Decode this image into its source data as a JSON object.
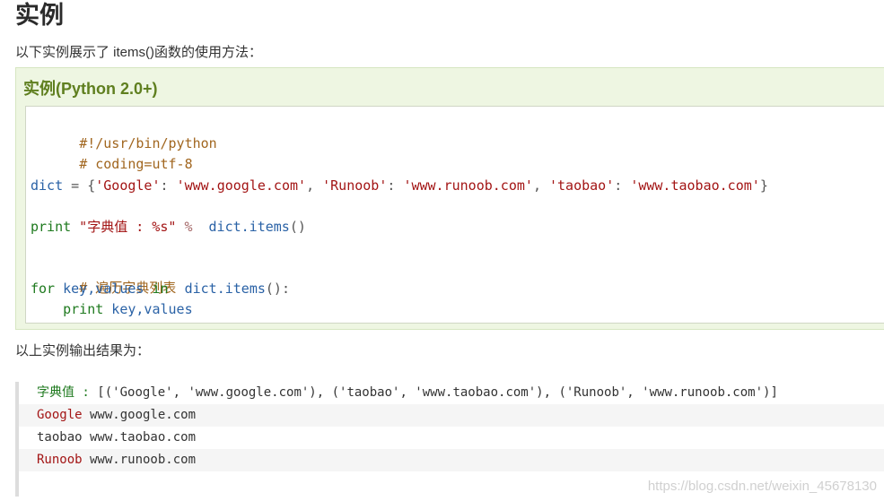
{
  "heading": "实例",
  "intro": "以下实例展示了 items()函数的使用方法：",
  "example": {
    "title": "实例(Python 2.0+)",
    "code": {
      "shebang": "#!/usr/bin/python",
      "coding": "# coding=utf-8",
      "dict_var": "dict",
      "dict_eq": " = {",
      "k1": "'Google'",
      "colon1": ": ",
      "v1": "'www.google.com'",
      "comma1": ", ",
      "k2": "'Runoob'",
      "colon2": ": ",
      "v2": "'www.runoob.com'",
      "comma2": ", ",
      "k3": "'taobao'",
      "colon3": ": ",
      "v3": "'www.taobao.com'",
      "close": "}",
      "print_kw": "print",
      "print_str": " \"字典值 : %s\" ",
      "print_op": "% ",
      "print_call": " dict.items",
      "print_paren": "()",
      "comment2": "# 遍历字典列表",
      "for_kw": "for",
      "for_vars": " key,values ",
      "in_kw": "in",
      "for_call": "  dict.items",
      "for_end": "():",
      "print2_kw": "    print",
      "print2_vars": " key,values"
    }
  },
  "result_intro": "以上实例输出结果为：",
  "output": {
    "line1_prefix": "字典值 : ",
    "line1_body": "[('Google', 'www.google.com'), ('taobao', 'www.taobao.com'), ('Runoob', 'www.runoob.com')]",
    "line2_key": "Google",
    "line2_val": " www.google.com",
    "line3_key": "taobao",
    "line3_val": " www.taobao.com",
    "line4_key": "Runoob",
    "line4_val": " www.runoob.com"
  },
  "watermark": "https://blog.csdn.net/weixin_45678130"
}
